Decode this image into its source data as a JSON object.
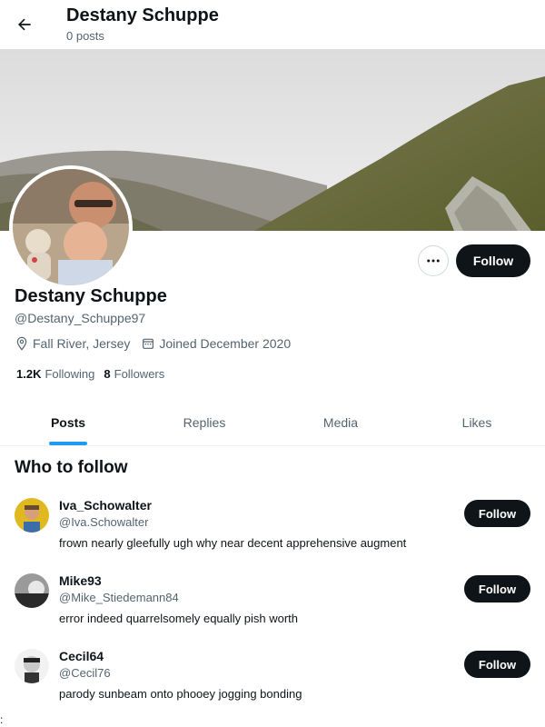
{
  "header": {
    "title": "Destany Schuppe",
    "subtitle": "0 posts"
  },
  "profile": {
    "display_name": "Destany Schuppe",
    "handle": "@Destany_Schuppe97",
    "location": "Fall River, Jersey",
    "joined": "Joined December 2020",
    "following_count": "1.2K",
    "following_label": "Following",
    "followers_count": "8",
    "followers_label": "Followers",
    "follow_label": "Follow",
    "more_label": "···"
  },
  "tabs": [
    {
      "label": "Posts",
      "active": true
    },
    {
      "label": "Replies",
      "active": false
    },
    {
      "label": "Media",
      "active": false
    },
    {
      "label": "Likes",
      "active": false
    }
  ],
  "who_to_follow": {
    "title": "Who to follow",
    "users": [
      {
        "name": "Iva_Schowalter",
        "handle": "@Iva.Schowalter",
        "bio": "frown nearly gleefully ugh why near decent apprehensive augment",
        "follow_label": "Follow"
      },
      {
        "name": "Mike93",
        "handle": "@Mike_Stiedemann84",
        "bio": "error indeed quarrelsomely equally pish worth",
        "follow_label": "Follow"
      },
      {
        "name": "Cecil64",
        "handle": "@Cecil76",
        "bio": "parody sunbeam onto phooey jogging bonding",
        "follow_label": "Follow"
      }
    ]
  },
  "footer_mark": ":",
  "colors": {
    "accent": "#1d9bf0",
    "button_dark": "#0f1419",
    "secondary_text": "#536471"
  },
  "icons": {
    "back": "arrow-left-icon",
    "more": "more-horizontal-icon",
    "location": "location-pin-icon",
    "calendar": "calendar-icon"
  }
}
